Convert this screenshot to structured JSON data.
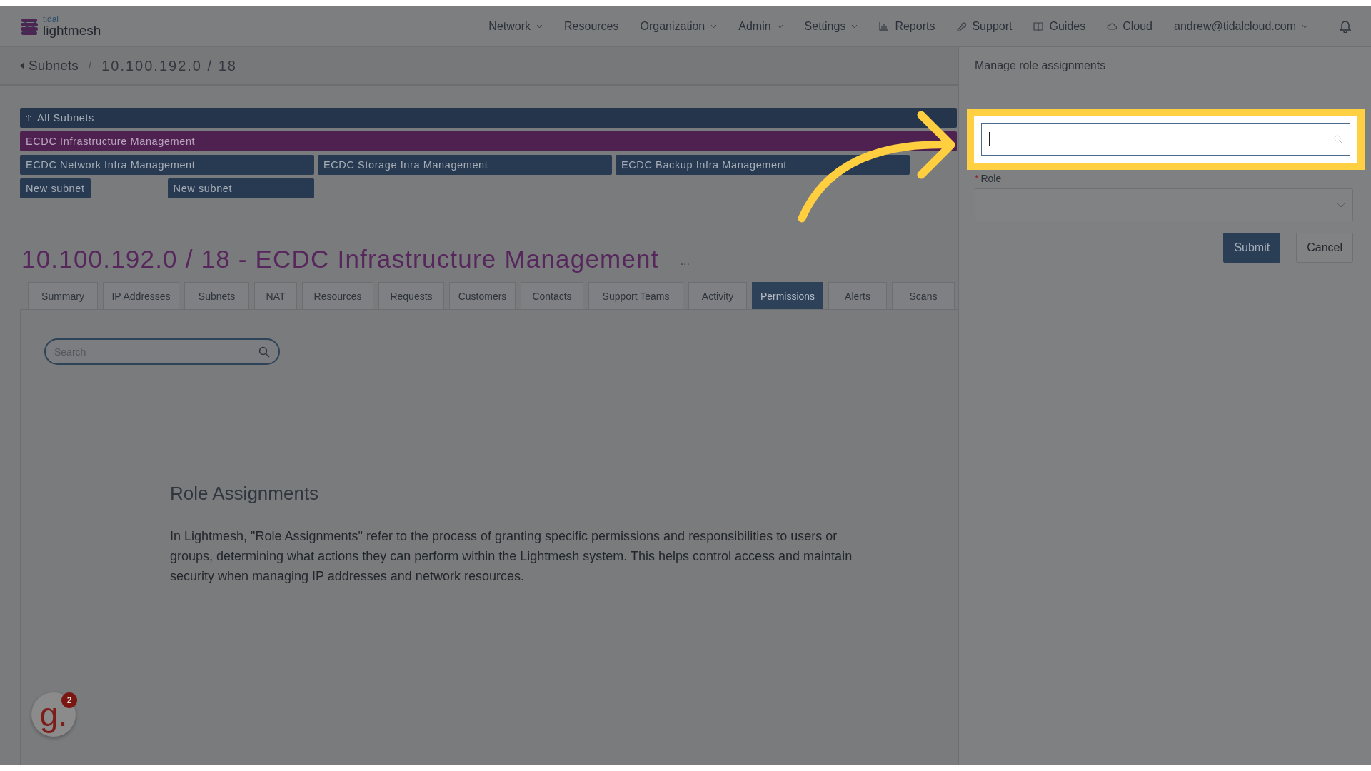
{
  "header": {
    "logo": {
      "small": "tidal",
      "name": "lightmesh"
    },
    "nav": [
      {
        "label": "Network",
        "kind": "menu"
      },
      {
        "label": "Resources",
        "kind": "link"
      },
      {
        "label": "Organization",
        "kind": "menu"
      },
      {
        "label": "Admin",
        "kind": "menu"
      },
      {
        "label": "Settings",
        "kind": "menu"
      },
      {
        "label": "Reports",
        "kind": "chart"
      },
      {
        "label": "Support",
        "kind": "wrench"
      },
      {
        "label": "Guides",
        "kind": "book"
      },
      {
        "label": "Cloud",
        "kind": "cloud"
      },
      {
        "label": "andrew@tidalcloud.com",
        "kind": "menu"
      }
    ]
  },
  "breadcrumb": {
    "back": "Subnets",
    "separator": "/",
    "current": "10.100.192.0 / 18"
  },
  "subnet_rows": [
    {
      "items": [
        {
          "label": "All Subnets",
          "kind": "parent"
        }
      ]
    },
    {
      "items": [
        {
          "label": "ECDC Infrastructure Management",
          "kind": "current"
        }
      ]
    },
    {
      "items": [
        {
          "label": "ECDC Network Infra Management",
          "kind": "child"
        },
        {
          "label": "ECDC Storage Inra Management",
          "kind": "child"
        },
        {
          "label": "ECDC Backup Infra Management",
          "kind": "child"
        }
      ]
    },
    {
      "items": [
        {
          "label": "New subnet",
          "kind": "new"
        },
        {
          "label": "New subnet",
          "kind": "new"
        }
      ]
    }
  ],
  "title": "10.100.192.0 / 18 - ECDC Infrastructure Management",
  "more": "...",
  "tabs": [
    {
      "label": "Summary",
      "selected": false
    },
    {
      "label": "IP Addresses",
      "selected": false
    },
    {
      "label": "Subnets",
      "selected": false
    },
    {
      "label": "NAT",
      "selected": false
    },
    {
      "label": "Resources",
      "selected": false
    },
    {
      "label": "Requests",
      "selected": false
    },
    {
      "label": "Customers",
      "selected": false
    },
    {
      "label": "Contacts",
      "selected": false
    },
    {
      "label": "Support Teams",
      "selected": false
    },
    {
      "label": "Activity",
      "selected": false
    },
    {
      "label": "Permissions",
      "selected": true
    },
    {
      "label": "Alerts",
      "selected": false
    },
    {
      "label": "Scans",
      "selected": false
    }
  ],
  "search": {
    "placeholder": "Search"
  },
  "section": {
    "heading": "Role Assignments",
    "text": "In Lightmesh, \"Role Assignments\" refer to the process of granting specific permissions and responsibilities to users or groups, determining what actions they can perform within the Lightmesh system. This helps control access and maintain security when managing IP addresses and network resources."
  },
  "panel": {
    "title": "Manage role assignments",
    "user_field": {
      "highlighted": true
    },
    "role_field": {
      "label": "Role",
      "required_mark": "*"
    },
    "buttons": [
      {
        "label": "Submit",
        "primary": true
      },
      {
        "label": "Cancel",
        "primary": false
      }
    ]
  },
  "help_widget": {
    "logo_text": "g.",
    "badge": "2"
  }
}
